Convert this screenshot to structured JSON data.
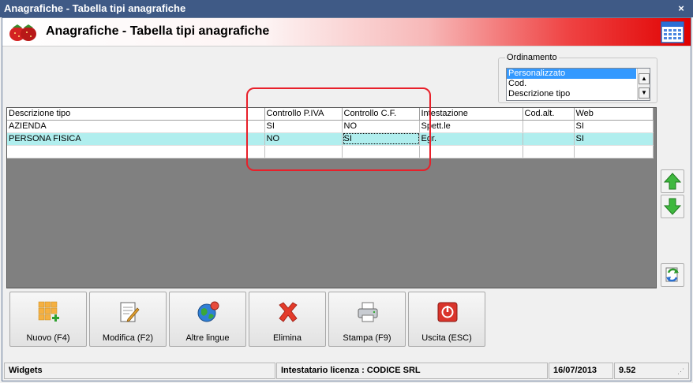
{
  "window": {
    "title": "Anagrafiche - Tabella tipi anagrafiche",
    "close_glyph": "×"
  },
  "header": {
    "title": "Anagrafiche - Tabella tipi anagrafiche",
    "logo_icon": "strawberries-icon",
    "calendar_icon": "calendar-icon"
  },
  "ordinamento": {
    "label": "Ordinamento",
    "items": [
      "Personalizzato",
      "Cod.",
      "Descrizione tipo"
    ],
    "selected": "Personalizzato",
    "scroll_up": "▲",
    "scroll_down": "▼"
  },
  "table": {
    "columns": [
      "Descrizione tipo",
      "Controllo P.IVA",
      "Controllo C.F.",
      "Intestazione",
      "Cod.alt.",
      "Web"
    ],
    "rows": [
      [
        "AZIENDA",
        "SI",
        "NO",
        "Spett.le",
        "",
        "SI"
      ],
      [
        "PERSONA FISICA",
        "NO",
        "SI",
        "Egr.",
        "",
        "SI"
      ]
    ]
  },
  "side_buttons": {
    "up_icon": "arrow-up-icon",
    "down_icon": "arrow-down-icon",
    "refresh_icon": "refresh-icon"
  },
  "toolbar": {
    "nuovo": "Nuovo (F4)",
    "modifica": "Modifica (F2)",
    "altre_lingue": "Altre lingue",
    "elimina": "Elimina",
    "stampa": "Stampa (F9)",
    "uscita": "Uscita (ESC)"
  },
  "status": {
    "widgets": "Widgets",
    "licenza": "Intestatario licenza : CODICE SRL",
    "date": "16/07/2013",
    "version": "9.52"
  },
  "colors": {
    "title_bar": "#3f5a86",
    "header_red": "#e00000",
    "highlight_row": "#b0eeee",
    "annotation": "#e8202a"
  }
}
